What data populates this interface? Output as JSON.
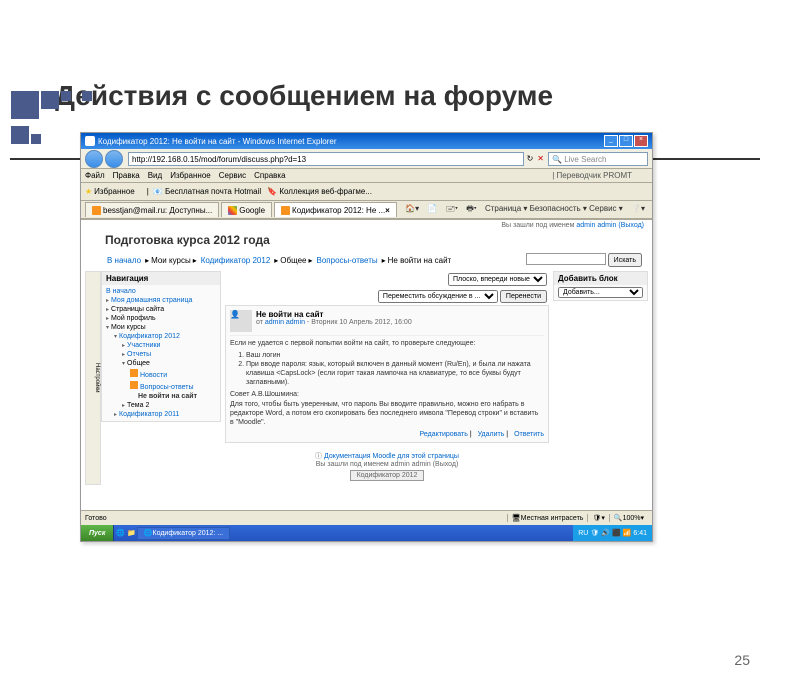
{
  "slide": {
    "title": "Действия с сообщением на форуме",
    "pagenum": "25"
  },
  "browser": {
    "title": "Кодификатор 2012: Не войти на сайт - Windows Internet Explorer",
    "url": "http://192.168.0.15/mod/forum/discuss.php?d=13",
    "search": "Live Search",
    "menu": [
      "Файл",
      "Правка",
      "Вид",
      "Избранное",
      "Сервис",
      "Справка"
    ],
    "translator": "Переводчик PROMT",
    "favorites": "Избранное",
    "favlink": "Бесплатная почта Hotmail",
    "favlink2": "Коллекция веб-фрагме...",
    "tabs": [
      {
        "label": "besstjan@mail.ru: Доступны..."
      },
      {
        "label": "Google"
      },
      {
        "label": "Кодификатор 2012: Не ..."
      }
    ],
    "rtools": "Страница ▾  Безопасность ▾  Сервис ▾",
    "status": "Готово",
    "zone": "Местная интрасеть",
    "zoom": "100%"
  },
  "moodle": {
    "login": "Вы зашли под именем",
    "user": "admin admin",
    "logout": "(Выход)",
    "course": "Подготовка курса 2012 года",
    "breadcrumb": [
      "В начало",
      "Мои курсы",
      "Кодификатор 2012",
      "Общее",
      "Вопросы-ответы",
      "Не войти на сайт"
    ],
    "searchbtn": "Искать",
    "nav": {
      "title": "Навигация",
      "items": [
        {
          "l": 1,
          "t": "В начало",
          "link": true
        },
        {
          "l": 1,
          "t": "Моя домашняя страница",
          "link": true,
          "tri": "▸"
        },
        {
          "l": 1,
          "t": "Страницы сайта",
          "tri": "▸"
        },
        {
          "l": 1,
          "t": "Мой профиль",
          "tri": "▸"
        },
        {
          "l": 1,
          "t": "Мои курсы",
          "tri": "▾"
        },
        {
          "l": 2,
          "t": "Кодификатор 2012",
          "link": true,
          "tri": "▾"
        },
        {
          "l": 3,
          "t": "Участники",
          "link": true,
          "tri": "▸"
        },
        {
          "l": 3,
          "t": "Отчеты",
          "link": true,
          "tri": "▸"
        },
        {
          "l": 3,
          "t": "Общее",
          "tri": "▾"
        },
        {
          "l": 4,
          "t": "Новости",
          "link": true,
          "ico": true
        },
        {
          "l": 4,
          "t": "Вопросы-ответы",
          "link": true,
          "ico": true
        },
        {
          "l": 5,
          "t": "Не войти на сайт",
          "cur": true
        },
        {
          "l": 3,
          "t": "Тема 2",
          "tri": "▸"
        },
        {
          "l": 2,
          "t": "Кодификатор 2011",
          "link": true,
          "tri": "▸"
        }
      ]
    },
    "display": {
      "mode": "Плоско, впереди новые",
      "move": "Переместить обсуждение в ...",
      "movebtn": "Перенести"
    },
    "addblock": {
      "title": "Добавить блок",
      "opt": "Добавить..."
    },
    "post": {
      "subject": "Не войти на сайт",
      "by": "от ",
      "author": "admin admin",
      "date": " - Вторник 10 Апрель 2012, 16:00",
      "body1": "Если не удается с первой попытки войти на сайт, то проверьте следующее:",
      "li1": "Ваш логин",
      "li2": "При вводе пароля: язык, который включен в данный момент (Ru/En), и была ли нажата клавиша <CapsLock> (если горит такая лампочка на клавиатуре, то все буквы будут заглавными).",
      "body2": "Совет А.В.Шошмина:",
      "body3": "Для того, чтобы быть уверенным, что пароль Вы вводите правильно, можно его набрать в редакторе Word, а потом его скопировать без последнего имвола \"Перевод строки\" и вставить в \"Moodle\".",
      "edit": "Редактировать",
      "del": "Удалить",
      "reply": "Ответить"
    },
    "footer": {
      "doc": "Документация Moodle для этой страницы",
      "login2": "Вы зашли под именем admin admin (Выход)",
      "home": "Кодификатор 2012"
    }
  },
  "taskbar": {
    "start": "Пуск",
    "task": "Кодификатор 2012: ...",
    "time": "6:41",
    "lang": "RU"
  }
}
